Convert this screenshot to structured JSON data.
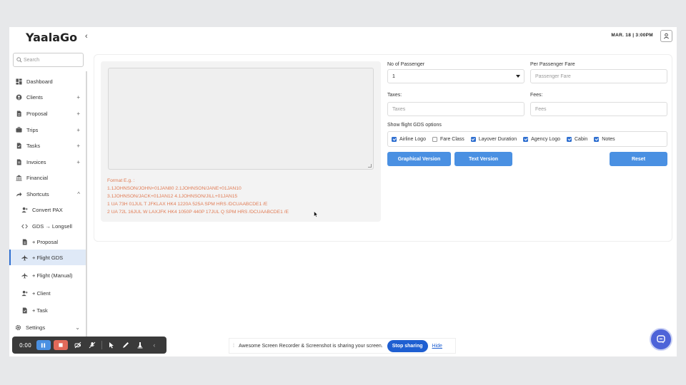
{
  "app": {
    "logo": "YaalaGo",
    "datetime": "Mar. 18 | 3:00pm"
  },
  "search": {
    "placeholder": "Search"
  },
  "sidebar": {
    "items": [
      {
        "label": "Dashboard",
        "icon": "dashboard-icon",
        "plus": ""
      },
      {
        "label": "Clients",
        "icon": "clients-icon",
        "plus": "+"
      },
      {
        "label": "Proposal",
        "icon": "proposal-icon",
        "plus": "+"
      },
      {
        "label": "Trips",
        "icon": "trips-icon",
        "plus": "+"
      },
      {
        "label": "Tasks",
        "icon": "tasks-icon",
        "plus": "+"
      },
      {
        "label": "Invoices",
        "icon": "invoices-icon",
        "plus": "+"
      },
      {
        "label": "Financial",
        "icon": "bank-icon",
        "plus": ""
      },
      {
        "label": "Shortcuts",
        "icon": "share-icon",
        "plus": "^"
      }
    ],
    "shortcuts": [
      {
        "label": "Convert PAX",
        "icon": "user-add-icon"
      },
      {
        "label": "GDS → Longsell",
        "icon": "code-icon"
      },
      {
        "label": "+ Proposal",
        "icon": "proposal-icon"
      },
      {
        "label": "+ Flight GDS",
        "icon": "plane-icon"
      },
      {
        "label": "+ Flight (Manual)",
        "icon": "plane-icon"
      },
      {
        "label": "+ Client",
        "icon": "user-add-icon"
      },
      {
        "label": "+ Task",
        "icon": "tasks-icon"
      }
    ],
    "settings": {
      "label": "Settings",
      "chevron": "⌄"
    }
  },
  "format": {
    "title": "Format E.g. :",
    "lines": [
      "1.1JOHNSON/JOHN+01JAN80 2.1JOHNSON/JANE+01JAN10",
      "3.1JOHNSON/JACK+01JAN12 4.1JOHNSON/JILL+01JAN15",
      "1 UA 73H 01JUL T JFKLAX HK4 1220A 525A SPM HRS /DCUAABCDE1 /E",
      "2 UA 72L 16JUL W LAXJFK HK4 1050P 440P 17JUL Q SPM HRS /DCUAABCDE1 /E"
    ]
  },
  "form": {
    "passenger_label": "No of Passenger",
    "passenger_value": "1",
    "fare_label": "Per Passenger Fare",
    "fare_placeholder": "Passenger Fare",
    "taxes_label": "Taxes:",
    "taxes_placeholder": "Taxes",
    "fees_label": "Fees:",
    "fees_placeholder": "Fees",
    "options_label": "Show flight GDS options",
    "options": [
      {
        "label": "Airline Logo",
        "checked": true
      },
      {
        "label": "Fare Class",
        "checked": false
      },
      {
        "label": "Layover Duration",
        "checked": true
      },
      {
        "label": "Agency Logo",
        "checked": true
      },
      {
        "label": "Cabin",
        "checked": true
      },
      {
        "label": "Notes",
        "checked": true
      }
    ],
    "graphical_btn": "Graphical Version",
    "text_btn": "Text Version",
    "reset_btn": "Reset"
  },
  "recorder": {
    "time": "0:00"
  },
  "share": {
    "message": "Awesome Screen Recorder & Screenshot is sharing your screen.",
    "stop": "Stop sharing",
    "hide": "Hide"
  },
  "colors": {
    "accent": "#4a90e2",
    "format_text": "#e07b54",
    "active_bg": "#dfe9f7"
  }
}
